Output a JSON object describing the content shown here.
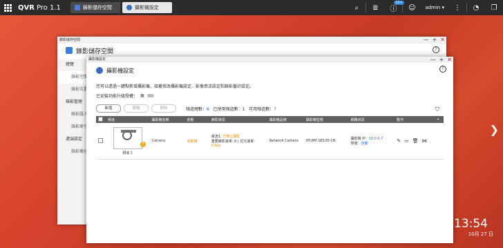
{
  "taskbar": {
    "brand": "QVR",
    "brand_version": "Pro 1.1",
    "tabs": [
      {
        "label": "錄影儲存空間"
      },
      {
        "label": "攝影機設定"
      }
    ],
    "notification_badge": "10+",
    "user": "admin"
  },
  "desktop": {
    "clock": "13:54",
    "date": "10月 27 日"
  },
  "window_storage": {
    "titlebar": "錄影儲存空間",
    "title": "錄影儲存空間",
    "sidebar": [
      {
        "label": "總覽",
        "sub": false
      },
      {
        "label": "錄影空間",
        "sub": true
      },
      {
        "label": "錄影位置",
        "sub": true
      },
      {
        "label": "錄影管理",
        "sub": false
      },
      {
        "label": "錄影匯入",
        "sub": true
      },
      {
        "label": "錄影索引",
        "sub": true
      },
      {
        "label": "遠端設定",
        "sub": false
      },
      {
        "label": "錄影備份",
        "sub": true
      }
    ]
  },
  "window_camera": {
    "titlebar": "攝影機設定",
    "title": "攝影機設定",
    "description": "您可以透過一鍵點新增攝影機，接著修改攝影機設定、影像串流設定和錄影番好設定。",
    "license_label": "已安裝功能升級授權：",
    "license_value": "無",
    "buttons": {
      "add": "新增",
      "edit": "編輯",
      "delete": "刪除"
    },
    "stats": {
      "total_label": "頻道總數：",
      "total": "8",
      "used_label": "已使用頻道數：",
      "used": "1",
      "avail_label": "可用頻道數：",
      "avail": "7"
    },
    "table": {
      "headers": [
        "頻道",
        "攝影機名稱",
        "狀態",
        "錄影資訊",
        "攝影機品牌",
        "攝影機型號",
        "網路資訊",
        "動作"
      ],
      "rows": [
        {
          "channel": "頻道 1",
          "name": "Camera",
          "status": "未啟用",
          "rec_line1_label": "串流1: ",
          "rec_line1_value": "已停止錄影",
          "rec_line2": "重要錄影速率: 0 | 位元速率:",
          "rec_line3": "0 bps",
          "brand": "Network Camera",
          "model": "IPCAM GE100-CB",
          "ip_label": "攝影機 IP：",
          "ip": "10.0.0.7",
          "port_label": "埠號：",
          "port": "自動"
        }
      ]
    }
  },
  "colors": {
    "accent": "#2a6bd0",
    "warning": "#f08a00",
    "header_bg": "#5f5f5f"
  }
}
